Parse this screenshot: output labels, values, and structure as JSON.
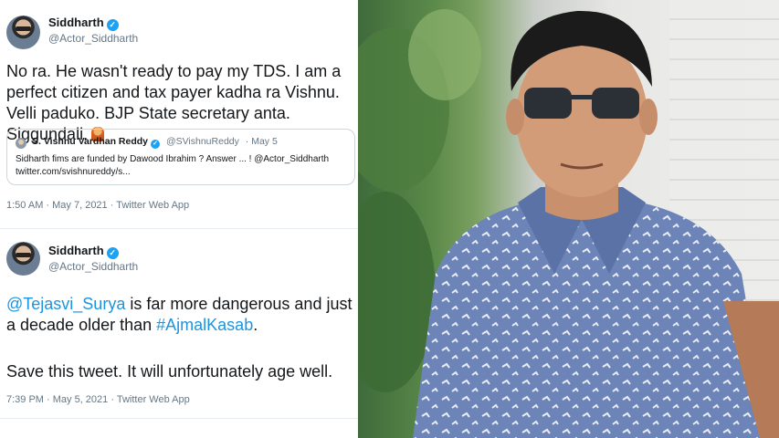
{
  "tweet1": {
    "name": "Siddharth",
    "handle": "@Actor_Siddharth",
    "text": "No ra. He wasn't ready to pay my TDS. I am a perfect citizen and tax payer kadha ra Vishnu. Velli paduko. BJP State secretary anta. Siggundali.",
    "quote": {
      "name": "S. Vishnu Vardhan Reddy",
      "handle": "@SVishnuReddy",
      "date": "· May 5",
      "text": "Sidharth fims are funded by Dawood Ibrahim ? Answer ... ! @Actor_Siddharth twitter.com/svishnureddy/s..."
    },
    "meta": "1:50 AM · May 7, 2021 · Twitter Web App"
  },
  "tweet2": {
    "name": "Siddharth",
    "handle": "@Actor_Siddharth",
    "mention": "@Tejasvi_Surya",
    "text_a": " is far more dangerous and just a decade older  than ",
    "hashtag": "#AjmalKasab",
    "text_b": ".",
    "text_c": "Save this tweet. It will unfortunately age well.",
    "meta": "7:39 PM · May 5, 2021 · Twitter Web App"
  },
  "colors": {
    "link": "#1b95e0",
    "verified": "#1da1f2",
    "muted": "#657786"
  },
  "icons": {
    "verified": "verified-badge-icon"
  }
}
